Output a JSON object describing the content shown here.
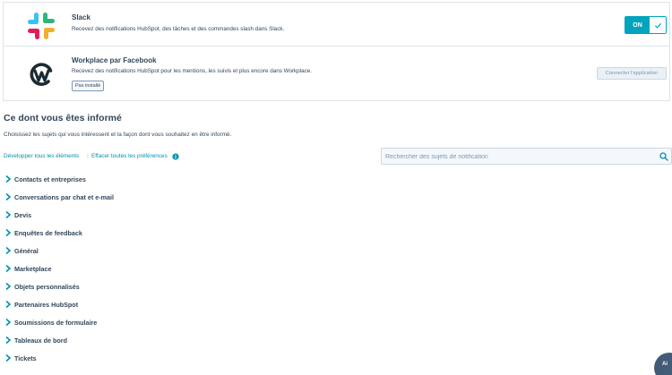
{
  "integrations": {
    "slack": {
      "name": "Slack",
      "description": "Recevez des notifications HubSpot, des tâches et des commandes slash dans Slack.",
      "toggle_label": "ON",
      "logo_icon": "slack-logo-icon"
    },
    "workplace": {
      "name": "Workplace par Facebook",
      "description": "Recevez des notifications HubSpot pour les mentions, les suivis et plus encore dans Workplace.",
      "badge": "Pas installé",
      "connect_label": "Connecter l'application",
      "logo_icon": "workplace-logo-icon"
    }
  },
  "section": {
    "title": "Ce dont vous êtes informé",
    "description": "Choisissez les sujets qui vous intéressent et la façon dont vous souhaitez en être informé.",
    "expand_all": "Développer tous les éléments",
    "separator": "|",
    "clear_prefs": "Effacer toutes les préférences"
  },
  "search": {
    "placeholder": "Rechercher des sujets de notification"
  },
  "topics": [
    {
      "label": "Contacts et entreprises"
    },
    {
      "label": "Conversations par chat et e-mail"
    },
    {
      "label": "Devis"
    },
    {
      "label": "Enquêtes de feedback"
    },
    {
      "label": "Général"
    },
    {
      "label": "Marketplace"
    },
    {
      "label": "Objets personnalisés"
    },
    {
      "label": "Partenaires HubSpot"
    },
    {
      "label": "Soumissions de formulaire"
    },
    {
      "label": "Tableaux de bord"
    },
    {
      "label": "Tickets"
    }
  ],
  "help": {
    "label": "Ai"
  },
  "colors": {
    "accent": "#00a4bd",
    "link": "#0091ae",
    "text": "#33475b",
    "border": "#dfe3eb",
    "muted": "#7c98b6"
  }
}
